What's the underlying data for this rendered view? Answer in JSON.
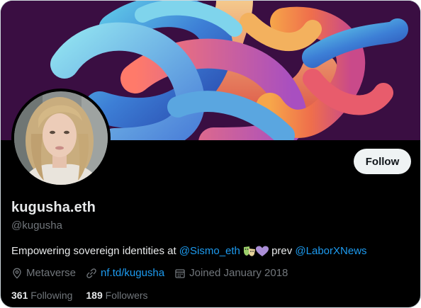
{
  "profile": {
    "display_name": "kugusha.eth",
    "handle": "@kugusha",
    "follow_label": "Follow"
  },
  "bio": {
    "prefix": "Empowering sovereign identities at ",
    "mention_1": "@Sismo_eth",
    "emoji_1": "theater-masks-emoji",
    "emoji_2": "purple-heart-emoji",
    "middle": " prev ",
    "mention_2": "@LaborXNews"
  },
  "meta": {
    "location": "Metaverse",
    "location_icon": "location-pin-icon",
    "website": "nf.td/kugusha",
    "website_icon": "link-icon",
    "joined": "Joined January 2018",
    "joined_icon": "calendar-icon"
  },
  "stats": {
    "following_count": "361",
    "following_label": "Following",
    "followers_count": "189",
    "followers_label": "Followers"
  },
  "colors": {
    "background": "#000000",
    "text_primary": "#e7e9ea",
    "text_secondary": "#71767b",
    "link": "#1d9bf0",
    "follow_button_bg": "#eff3f4",
    "follow_button_text": "#0f1419",
    "banner_bg": "#3a0e42"
  }
}
